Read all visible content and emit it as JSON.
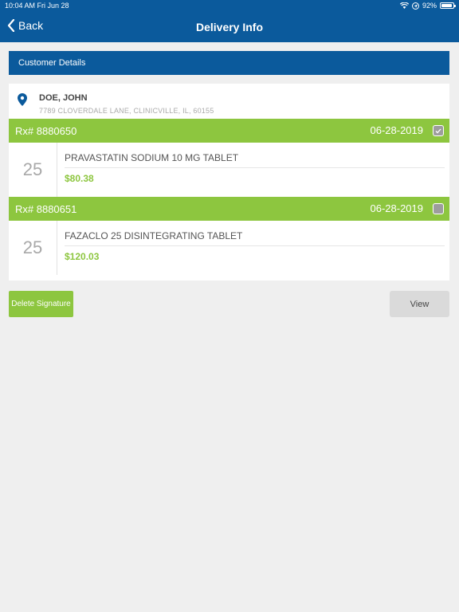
{
  "status_bar": {
    "time": "10:04 AM   Fri Jun 28",
    "battery": "92%",
    "battery_level": 0.92
  },
  "nav": {
    "back_label": "Back",
    "title": "Delivery Info"
  },
  "section": {
    "title": "Customer Details"
  },
  "customer": {
    "name": "DOE, JOHN",
    "address": "7789 CLOVERDALE LANE, CLINICVILLE, IL, 60155"
  },
  "prescriptions": [
    {
      "rx": "Rx# 8880650",
      "date": "06-28-2019",
      "checked": true,
      "qty": "25",
      "drug": "PRAVASTATIN SODIUM 10 MG TABLET",
      "price": "$80.38"
    },
    {
      "rx": "Rx# 8880651",
      "date": "06-28-2019",
      "checked": false,
      "qty": "25",
      "drug": "FAZACLO 25 DISINTEGRATING TABLET",
      "price": "$120.03"
    }
  ],
  "actions": {
    "delete_label": "Delete Signature",
    "view_label": "View"
  },
  "colors": {
    "brand_blue": "#0b5a9c",
    "accent_green": "#8dc63f",
    "background": "#efefef"
  }
}
